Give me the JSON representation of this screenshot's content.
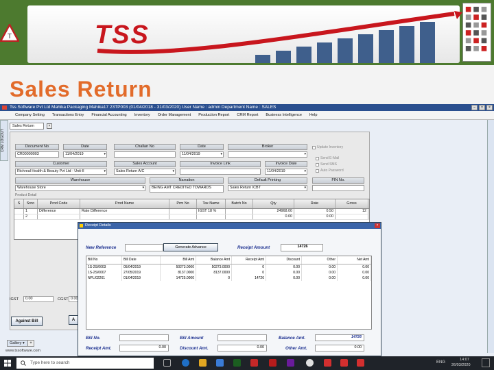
{
  "banner": {
    "logo": "TSS",
    "title": "Sales Return"
  },
  "app": {
    "title": "Tss Software Pvt Ltd  Mahika Packaging   Mahika17 23TP003   (01/04/2018 - 31/03/2020)   User Name : admin   Department Name : SALES",
    "menu": [
      "Company Setting",
      "Transactions Entry",
      "Financial Accounting",
      "Inventory",
      "Order Management",
      "Production Report",
      "CRM Report",
      "Business Intelligence",
      "Help"
    ],
    "side_tab": "CRM LOGOUT",
    "tab": "Sales Return"
  },
  "form": {
    "document_no_label": "Document No",
    "document_no": "CR00000003",
    "date_label": "Date",
    "date": "11/04/2019",
    "challan_no_label": "Challan No",
    "challan_no": "",
    "date2_label": "Date",
    "date2": "11/04/2019",
    "broker_label": "Broker",
    "broker": "",
    "customer_label": "Customer",
    "customer": "Richreal Health & Beauty Pvt Ltd - Unit-II",
    "sales_account_label": "Sales Account",
    "sales_account": "Sales Return A/C",
    "invoice_link_label": "Invoice Link",
    "invoice_link": "",
    "invoice_date_label": "Invoice Date",
    "invoice_date": "11/04/2019",
    "warehouse_label": "Warehouse",
    "warehouse": "Warehouse Store",
    "narration_label": "Narration",
    "narration": "BEING AMT CREDITED TOWARDS",
    "default_printing_label": "Default Printing",
    "default_printing": "Sales Return ICBT",
    "fin_no_label": "FIN No.",
    "fin_no": "",
    "product_detail": "Product Detail",
    "checks": [
      "Update Inventory",
      "Send E-Mail",
      "Send SMS",
      "Auto Password"
    ],
    "grid_headers": [
      "S",
      "Srno",
      "Prod Code",
      "Prod Name",
      "Prm No",
      "Tax Name",
      "Batch No",
      "Qty",
      "Rate",
      "Gross"
    ],
    "grid_rows": [
      [
        "",
        "1",
        "Difference",
        "Rate Difference",
        "",
        "IGST 18 %",
        "",
        "24968.00",
        "0.50",
        "12"
      ],
      [
        "",
        "2",
        "",
        "",
        "",
        "",
        "",
        "0.00",
        "0.00",
        ""
      ]
    ],
    "igst_label": "IGST",
    "igst": "0.00",
    "cgst_label": "CGST",
    "cgst": "0.00",
    "against_bill": "Against Bill",
    "gallery": "Gallery",
    "status_url": "www.tssoftware.com"
  },
  "dialog": {
    "title": "Receipt Details",
    "new_reference_label": "New Reference",
    "new_reference": "",
    "generate_advance": "Generate Advance",
    "receipt_amount_label": "Receipt Amount",
    "receipt_amount": "14726",
    "headers": [
      "Bill No",
      "Bill Date",
      "Bill Amt",
      "Balance Amt",
      "Receipt Amt",
      "Discount",
      "Other",
      "Net Amt"
    ],
    "rows": [
      [
        "1S-2S/0003",
        "05/04/2019",
        "50273.0000",
        "50273.0000",
        "0",
        "0.00",
        "0.00",
        "0.00"
      ],
      [
        "1S-2S/0007",
        "27/05/2019",
        "8137.0000",
        "8137.0000",
        "0",
        "0.00",
        "0.00",
        "0.00"
      ],
      [
        "NPL/02261",
        "01/04/2019",
        "14725.0000",
        "0",
        "14726",
        "0.00",
        "0.00",
        "0.00"
      ]
    ],
    "bill_no_label": "Bill No.",
    "bill_no": "",
    "bill_amount_label": "Bill Amount",
    "bill_amount": "",
    "balance_amt_label": "Balance Amt.",
    "balance_amt": "14726",
    "receipt_amt_label": "Receipt Amt.",
    "receipt_amt": "0.00",
    "discount_amt_label": "Discount Amt.",
    "discount_amt": "0.00",
    "other_amt_label": "Other Amt.",
    "other_amt": "0.00"
  },
  "taskbar": {
    "search_placeholder": "Type here to search",
    "lang": "ENG",
    "time": "14:07",
    "date": "26/03/2020"
  },
  "colors": {
    "banner_green": "#4d7a2f",
    "title_orange": "#e26b2a",
    "logo_red": "#c8161d",
    "dialog_label_blue": "#1b2f8f"
  }
}
